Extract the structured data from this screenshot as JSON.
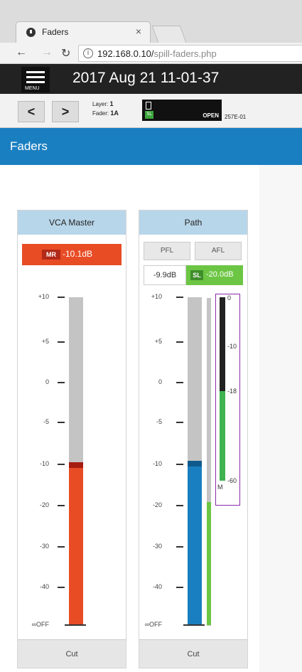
{
  "browser": {
    "tab_title": "Faders",
    "tab_close": "×",
    "url_host": "192.168.0.10/",
    "url_path": "spill-faders.php"
  },
  "app": {
    "menu_label": "MENU",
    "datetime": "2017 Aug 21 11-01-37",
    "nav_prev": "<",
    "nav_next": ">",
    "layer_label": "Layer:",
    "layer_value": "1",
    "fader_label": "Fader:",
    "fader_value": "1A",
    "channel_badge": "SL",
    "channel_status": "OPEN",
    "channel_id": "257E-01"
  },
  "page": {
    "title": "Faders"
  },
  "strips": [
    {
      "name": "VCA Master",
      "level_tag": "MR",
      "level_value": "-10.1dB",
      "fader_db": -10.1,
      "color": "#e84c25",
      "cut_label": "Cut"
    },
    {
      "name": "Path",
      "pfl_label": "PFL",
      "afl_label": "AFL",
      "fader_value_text": "-9.9dB",
      "sl_tag": "SL",
      "sl_value": "-20.0dB",
      "fader_db": -9.9,
      "color": "#1a7fc1",
      "cut_label": "Cut",
      "meter_labels": [
        "0",
        "-10",
        "-18",
        "-60",
        "M"
      ]
    }
  ],
  "scale_labels": [
    "+10",
    "+5",
    "0",
    "-5",
    "-10",
    "-20",
    "-30",
    "-40",
    "∞OFF"
  ],
  "colors": {
    "accent": "#1a7fc1",
    "mr_red": "#e84c25",
    "sl_green": "#6cc644"
  }
}
